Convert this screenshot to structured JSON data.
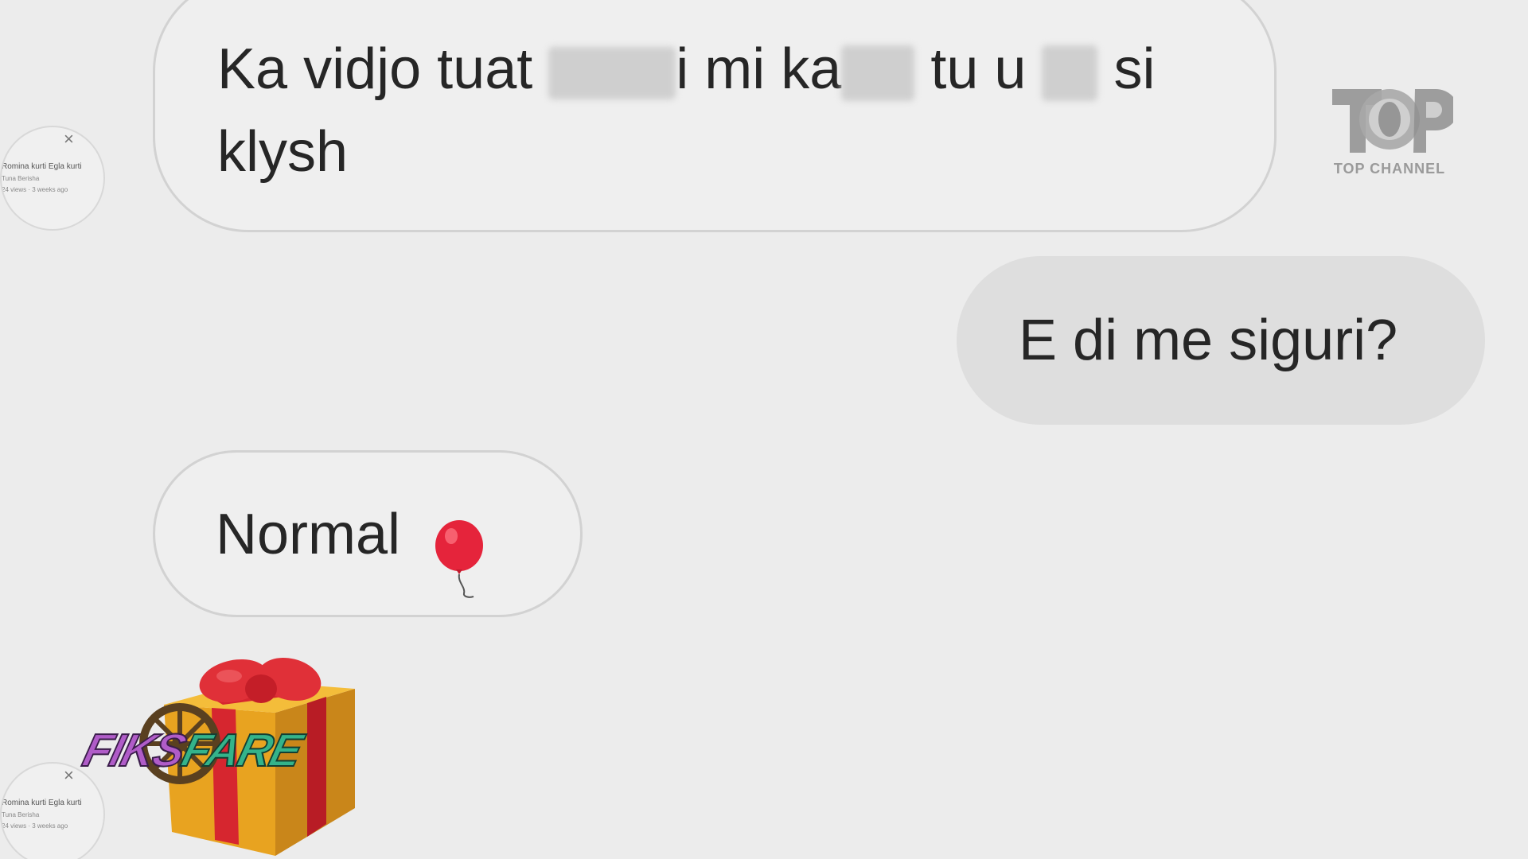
{
  "watermark": {
    "logo_text": "TOP CHANNEL"
  },
  "overlay": {
    "show_logo_part1": "FIKS",
    "show_logo_part2": "FARE"
  },
  "avatar": {
    "close_glyph": "×",
    "line1": "Romina kurti Egla kurti",
    "line2": "Tuna Berisha",
    "line3": "24 views · 3 weeks ago"
  },
  "messages": [
    {
      "direction": "incoming",
      "segments": [
        "Ka vidjo tuat",
        "i mi ka",
        "tu u",
        "si"
      ],
      "line2": "klysh"
    },
    {
      "direction": "outgoing",
      "text": "E di me siguri?"
    },
    {
      "direction": "incoming",
      "text": "Normal",
      "emoji": "balloon-emoji"
    },
    {
      "direction": "incoming",
      "emoji": "gift-emoji"
    }
  ],
  "colors": {
    "background": "#ececec",
    "incoming_border": "#d2d2d2",
    "outgoing_fill": "#dedede",
    "text": "#262626",
    "balloon": "#e5243b",
    "gift_box": "#e8a320",
    "gift_ribbon": "#d6262f"
  }
}
